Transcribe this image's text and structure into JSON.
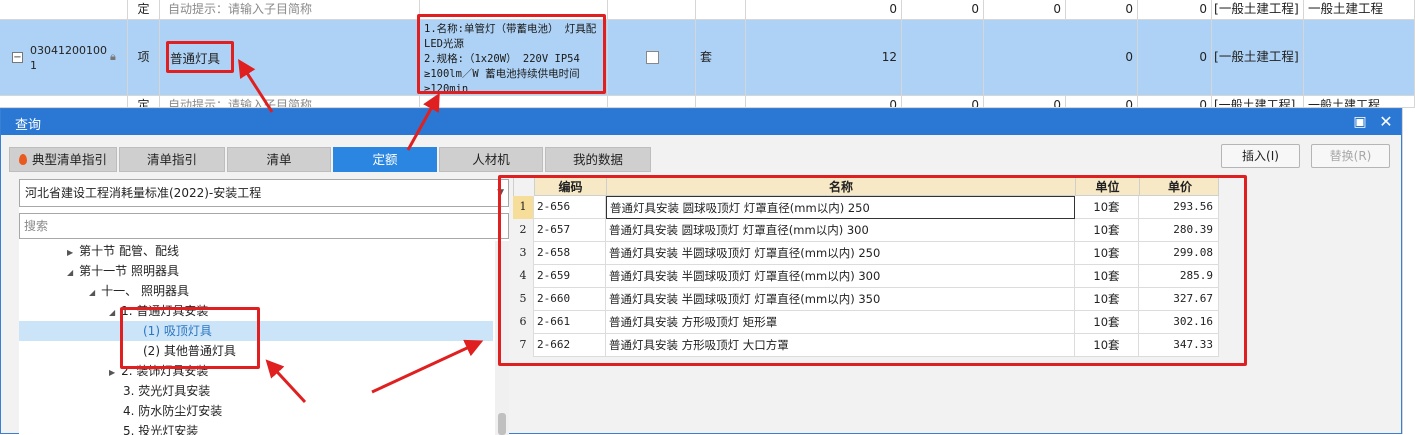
{
  "grid": {
    "top_row": {
      "type": "定",
      "hint": "自动提示：请输入子目简称",
      "values": [
        "0",
        "0",
        "0",
        "0",
        "0"
      ],
      "category": "[一般土建工程]",
      "category2": "一般土建工程"
    },
    "selected_row": {
      "code": "03041200100\n1",
      "type": "项",
      "name": "普通灯具",
      "description": "1.名称:单管灯（带蓄电池） 灯具配LED光源\n2.规格:（1x20W） 220V IP54 ≥100lm／W 蓄电池持续供电时间≥120min",
      "unit": "套",
      "quantity": "12",
      "value_a": "0",
      "value_b": "0",
      "category": "[一般土建工程]"
    },
    "bottom_row": {
      "type": "定",
      "hint": "自动提示：请输入子目简称",
      "values": [
        "0",
        "0",
        "0",
        "0",
        "0"
      ],
      "category": "[一般土建工程]",
      "category2": "一般土建工程"
    }
  },
  "dialog": {
    "title": "查询",
    "tabs": [
      {
        "label": "典型清单指引"
      },
      {
        "label": "清单指引"
      },
      {
        "label": "清单"
      },
      {
        "label": "定额"
      },
      {
        "label": "人材机"
      },
      {
        "label": "我的数据"
      }
    ],
    "insert_label": "插入(I)",
    "replace_label": "替换(R)",
    "library_selected": "河北省建设工程消耗量标准(2022)-安装工程",
    "search_placeholder": "搜索",
    "tree": [
      {
        "label": "第十节 配管、配线"
      },
      {
        "label": "第十一节 照明器具"
      },
      {
        "label": "十一、 照明器具"
      },
      {
        "label": "1. 普通灯具安装"
      },
      {
        "label": "(1) 吸顶灯具"
      },
      {
        "label": "(2) 其他普通灯具"
      },
      {
        "label": "2. 装饰灯具安装"
      },
      {
        "label": "3. 荧光灯具安装"
      },
      {
        "label": "4. 防水防尘灯安装"
      },
      {
        "label": "5. 投光灯安装"
      }
    ],
    "table": {
      "headers": {
        "code": "编码",
        "name": "名称",
        "unit": "单位",
        "price": "单价"
      },
      "rows": [
        {
          "idx": "1",
          "code": "2-656",
          "name": "普通灯具安装 圆球吸顶灯 灯罩直径(mm以内) 250",
          "unit": "10套",
          "price": "293.56"
        },
        {
          "idx": "2",
          "code": "2-657",
          "name": "普通灯具安装 圆球吸顶灯 灯罩直径(mm以内) 300",
          "unit": "10套",
          "price": "280.39"
        },
        {
          "idx": "3",
          "code": "2-658",
          "name": "普通灯具安装 半圆球吸顶灯 灯罩直径(mm以内) 250",
          "unit": "10套",
          "price": "299.08"
        },
        {
          "idx": "4",
          "code": "2-659",
          "name": "普通灯具安装 半圆球吸顶灯 灯罩直径(mm以内) 300",
          "unit": "10套",
          "price": "285.9"
        },
        {
          "idx": "5",
          "code": "2-660",
          "name": "普通灯具安装 半圆球吸顶灯 灯罩直径(mm以内) 350",
          "unit": "10套",
          "price": "327.67"
        },
        {
          "idx": "6",
          "code": "2-661",
          "name": "普通灯具安装 方形吸顶灯 矩形罩",
          "unit": "10套",
          "price": "302.16"
        },
        {
          "idx": "7",
          "code": "2-662",
          "name": "普通灯具安装 方形吸顶灯 大口方罩",
          "unit": "10套",
          "price": "347.33"
        }
      ]
    }
  },
  "colors": {
    "annotation": "#e02020",
    "titlebar": "#2a78d4",
    "active_tab": "#2a86e0",
    "selected_row": "#aed2f5",
    "table_header": "#f8e9c6"
  }
}
